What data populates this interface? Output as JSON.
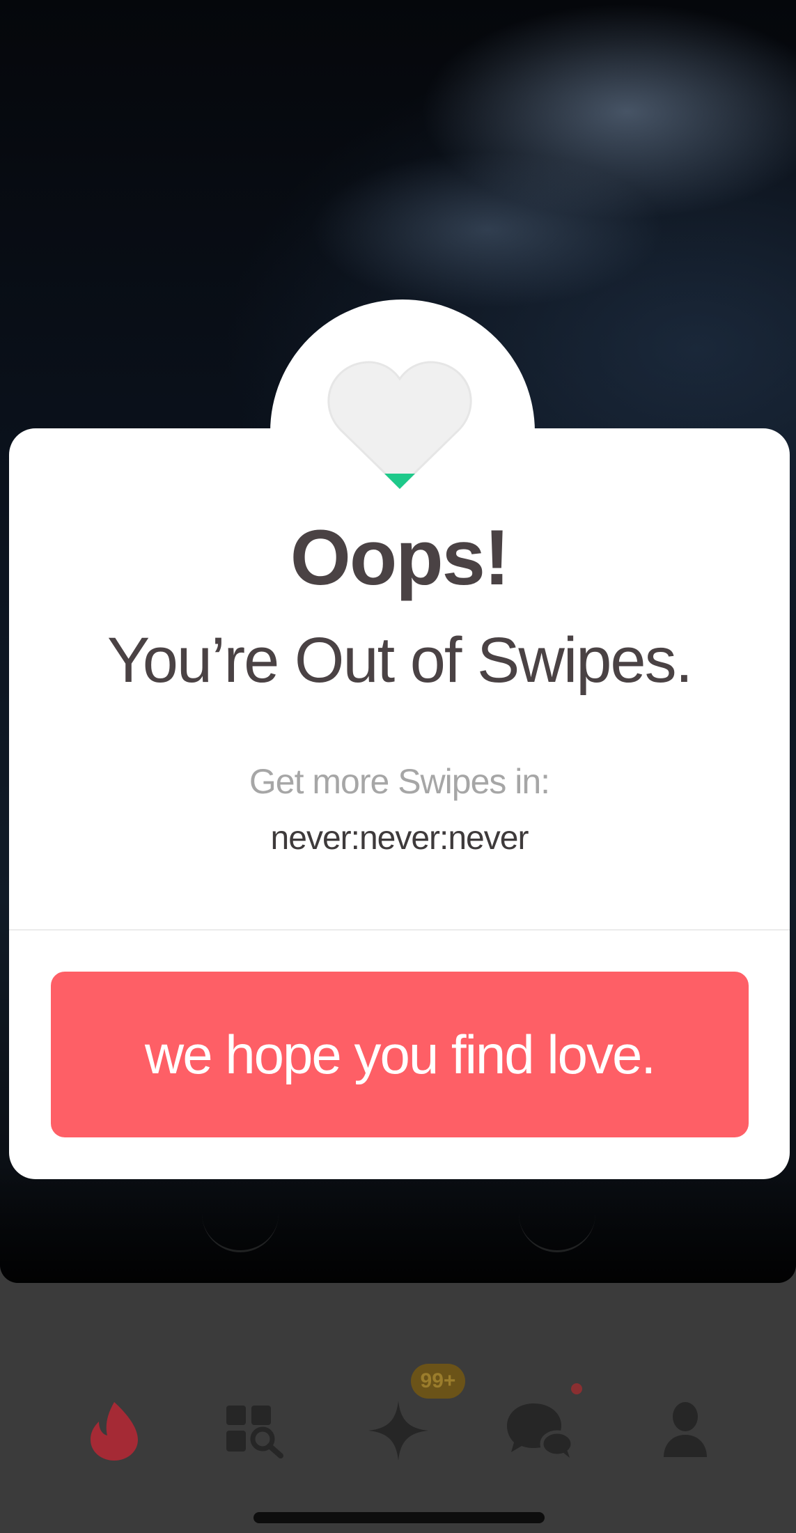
{
  "modal": {
    "title": "Oops!",
    "subtitle": "You’re Out of Swipes.",
    "countdown_label": "Get more Swipes in:",
    "countdown_value": "never:never:never",
    "cta_label": "we hope you find love."
  },
  "nav": {
    "items": [
      {
        "icon": "flame-icon",
        "active": true
      },
      {
        "icon": "explore-icon",
        "active": false
      },
      {
        "icon": "sparkle-icon",
        "active": false
      },
      {
        "icon": "chat-icon",
        "active": false
      },
      {
        "icon": "profile-icon",
        "active": false
      }
    ],
    "sparkle_badge": "99+"
  },
  "colors": {
    "accent": "#fe5f66",
    "heart_fill": "#f0f0f0",
    "heart_tip": "#1ec98a",
    "text_dark": "#4a4244",
    "text_muted": "#a6a6a6",
    "nav_active": "#a52a35",
    "nav_inactive": "#262626"
  }
}
